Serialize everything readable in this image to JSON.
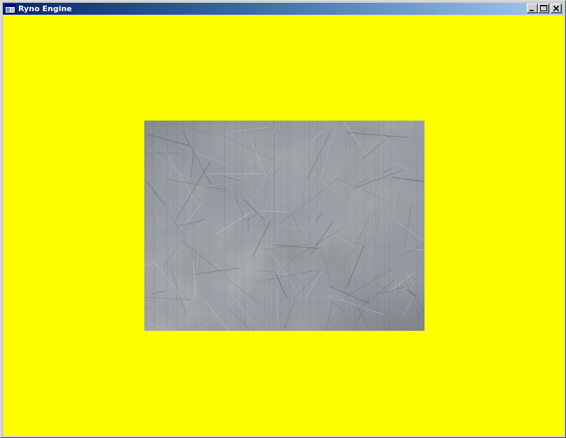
{
  "window": {
    "title": "Ryno Engine",
    "icon": "application-window-icon",
    "caption_buttons": [
      {
        "name": "minimize",
        "icon": "minimize-icon"
      },
      {
        "name": "maximize",
        "icon": "maximize-icon"
      },
      {
        "name": "close",
        "icon": "close-icon"
      }
    ]
  },
  "viewport": {
    "clear_color": "#ffff00",
    "quad": {
      "texture": "scratched-metal-texture",
      "base_color": "#8b9098"
    }
  }
}
